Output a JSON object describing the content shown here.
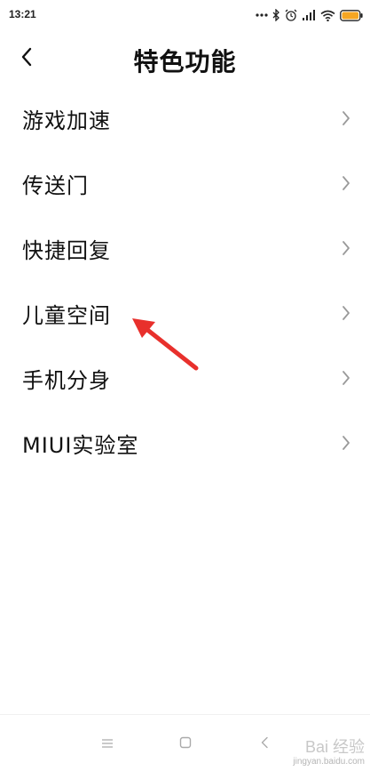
{
  "status_bar": {
    "time": "13:21",
    "icons": [
      "more-dots-icon",
      "bluetooth-icon",
      "alarm-icon",
      "signal-hd-icon",
      "wifi-icon",
      "battery-icon"
    ],
    "battery_color": "#f5a623"
  },
  "header": {
    "title": "特色功能",
    "back_icon": "chevron-left-icon"
  },
  "menu": {
    "items": [
      {
        "label": "游戏加速"
      },
      {
        "label": "传送门"
      },
      {
        "label": "快捷回复"
      },
      {
        "label": "儿童空间"
      },
      {
        "label": "手机分身"
      },
      {
        "label": "MIUI实验室"
      }
    ],
    "chevron_icon": "chevron-right-icon"
  },
  "annotation": {
    "icon": "red-arrow-icon",
    "color": "#e8302c",
    "points_to": "儿童空间"
  },
  "nav_bar": {
    "icons": [
      "menu-icon",
      "home-icon",
      "back-icon"
    ]
  },
  "watermark": {
    "main": "Bai 经验",
    "sub": "jingyan.baidu.com"
  },
  "colors": {
    "text": "#111111",
    "chevron": "#9a9a9a",
    "background": "#ffffff"
  }
}
